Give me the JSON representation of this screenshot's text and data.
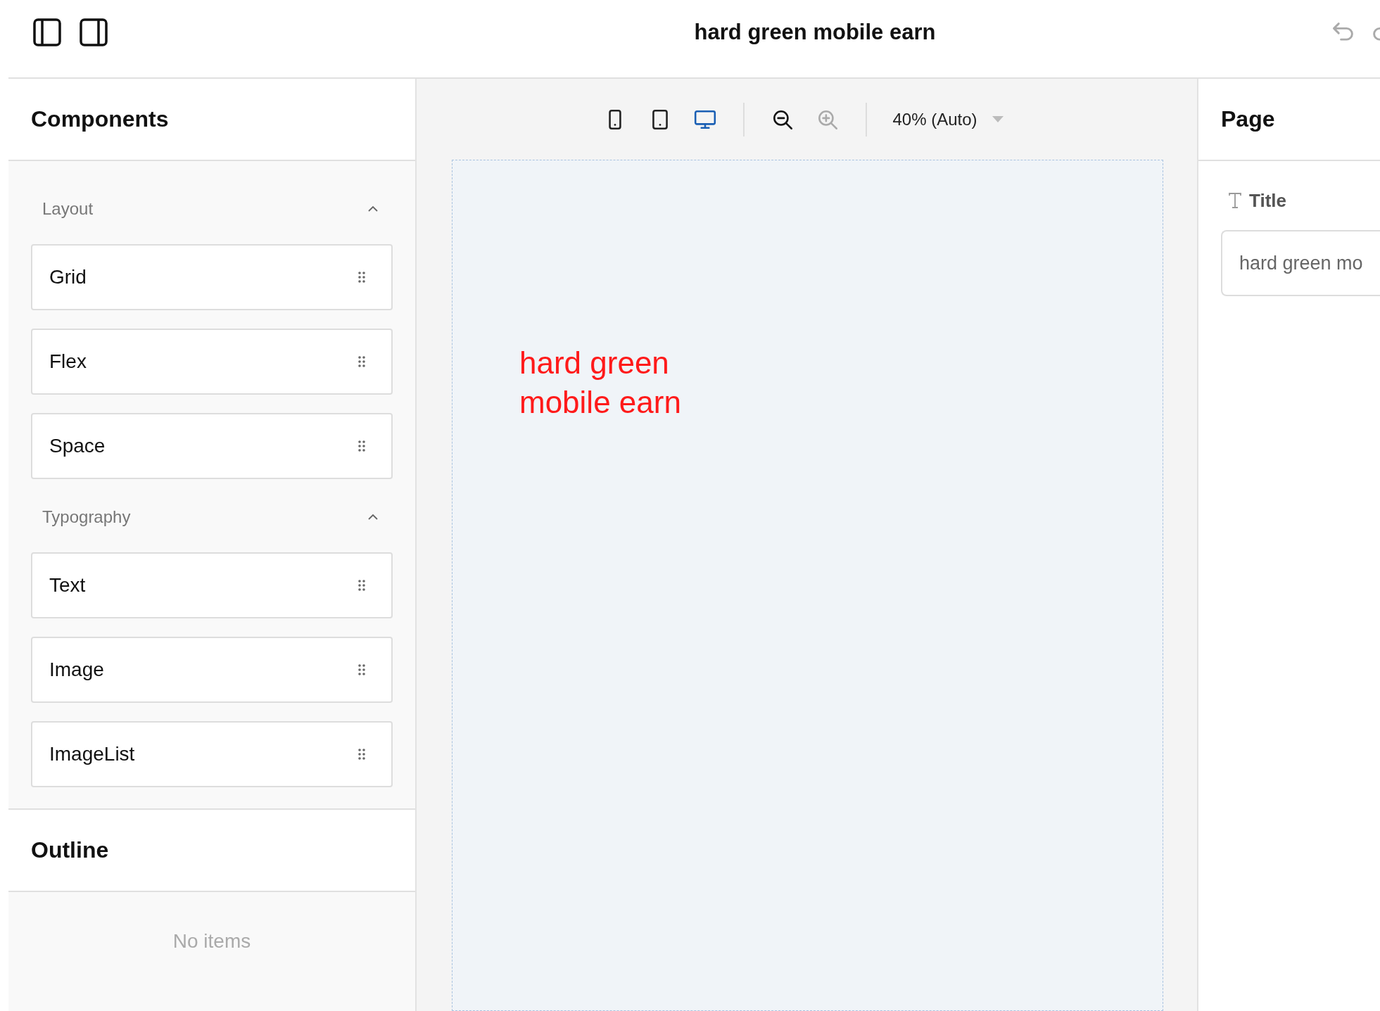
{
  "header": {
    "title": "hard green mobile earn"
  },
  "components": {
    "title": "Components",
    "groups": [
      {
        "label": "Layout",
        "expanded": true,
        "items": [
          "Grid",
          "Flex",
          "Space"
        ]
      },
      {
        "label": "Typography",
        "expanded": true,
        "items": [
          "Text",
          "Image",
          "ImageList"
        ]
      }
    ]
  },
  "outline": {
    "title": "Outline",
    "empty_text": "No items"
  },
  "toolbar": {
    "devices": [
      {
        "kind": "phone",
        "selected": false
      },
      {
        "kind": "tablet",
        "selected": false
      },
      {
        "kind": "desktop",
        "selected": true
      }
    ],
    "zoom_out": {
      "disabled": false
    },
    "zoom_in": {
      "disabled": true
    },
    "zoom_select": "40% (Auto)"
  },
  "canvas": {
    "text": "hard green\nmobile earn"
  },
  "page_panel": {
    "title": "Page",
    "field_label": "Title",
    "field_value": "hard green mo"
  }
}
